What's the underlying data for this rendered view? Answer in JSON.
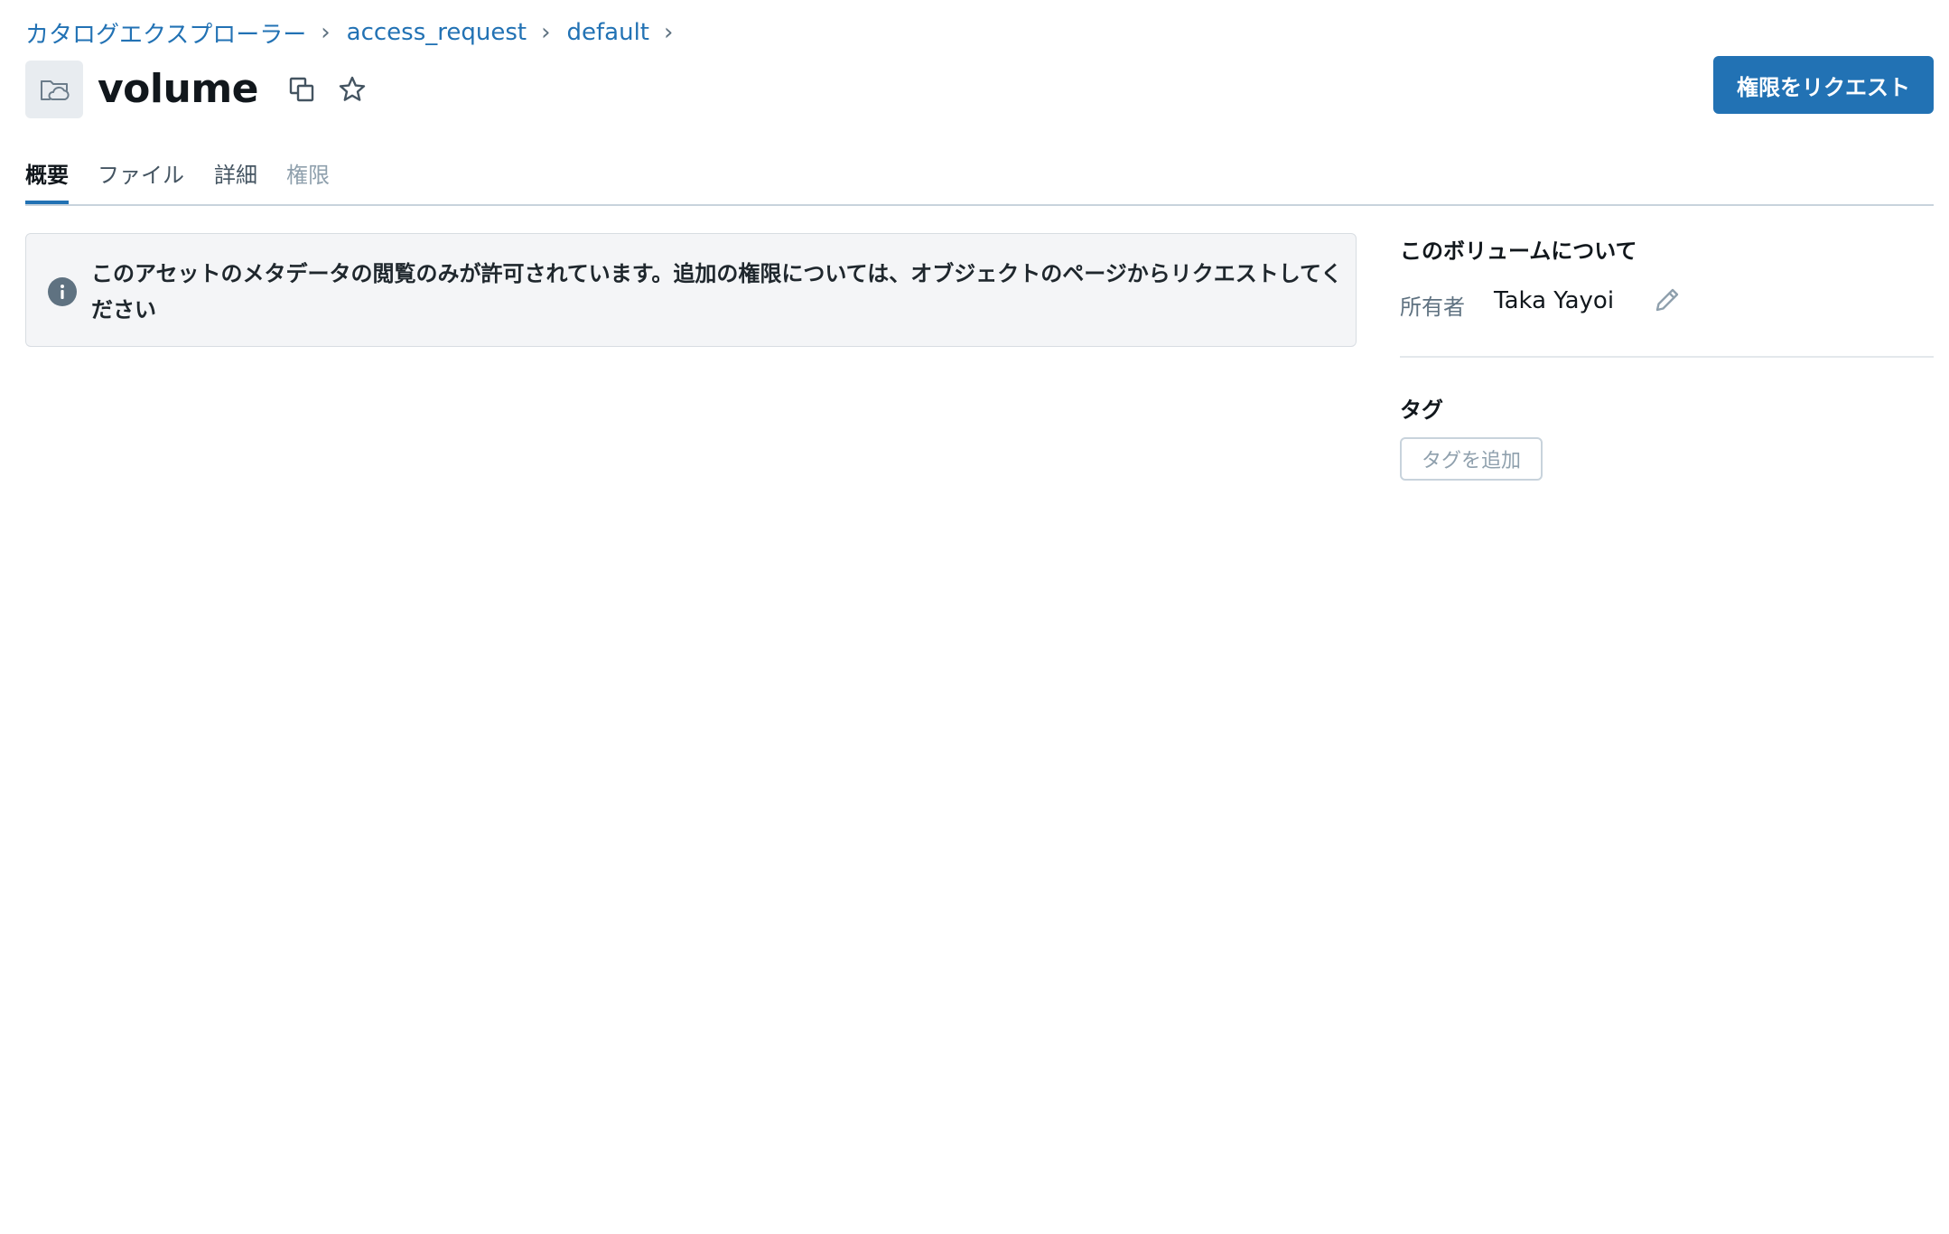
{
  "breadcrumb": {
    "items": [
      "カタログエクスプローラー",
      "access_request",
      "default"
    ],
    "separator": "›"
  },
  "header": {
    "title": "volume",
    "entity_icon": "volume-folder-icon",
    "request_button_label": "権限をリクエスト"
  },
  "tabs": [
    {
      "label": "概要",
      "state": "active"
    },
    {
      "label": "ファイル",
      "state": "normal"
    },
    {
      "label": "詳細",
      "state": "normal"
    },
    {
      "label": "権限",
      "state": "disabled"
    }
  ],
  "notice": {
    "icon": "info-icon",
    "text": "このアセットのメタデータの閲覧のみが許可されています。追加の権限については、オブジェクトのページからリクエストしてください"
  },
  "about": {
    "heading": "このボリュームについて",
    "owner_label": "所有者",
    "owner_value": "Taka Yayoi"
  },
  "tags": {
    "heading": "タグ",
    "add_label": "タグを追加"
  },
  "colors": {
    "accent": "#2272b4",
    "text": "#11171c",
    "muted": "#5f7281",
    "notice_bg": "#f4f5f7"
  }
}
